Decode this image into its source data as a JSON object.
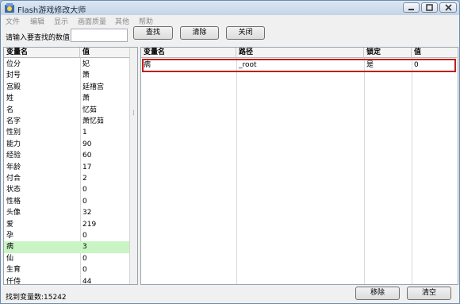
{
  "window": {
    "title": "Flash游戏修改大师",
    "icon": "app-icon",
    "controls": [
      "minimize-icon",
      "maximize-icon",
      "close-icon"
    ]
  },
  "menu": [
    "文件",
    "编辑",
    "显示",
    "画面质量",
    "其他",
    "帮助"
  ],
  "search": {
    "label": "请输入要查找的数值",
    "value": "",
    "find_label": "查找",
    "clear_label": "清除",
    "close_label": "关闭"
  },
  "left_table": {
    "headers": [
      "变量名",
      "值"
    ],
    "rows": [
      [
        "位分",
        "妃"
      ],
      [
        "封号",
        "箫"
      ],
      [
        "宫殿",
        "延禧宫"
      ],
      [
        "姓",
        "萧"
      ],
      [
        "名",
        "忆茹"
      ],
      [
        "名字",
        "萧忆茹"
      ],
      [
        "性别",
        "1"
      ],
      [
        "能力",
        "90"
      ],
      [
        "经验",
        "60"
      ],
      [
        "年龄",
        "17"
      ],
      [
        "付合",
        "2"
      ],
      [
        "状态",
        "0"
      ],
      [
        "性格",
        "0"
      ],
      [
        "头像",
        "32"
      ],
      [
        "爱",
        "219"
      ],
      [
        "孕",
        "0"
      ],
      [
        "病",
        "3"
      ],
      [
        "仙",
        "0"
      ],
      [
        "生育",
        "0"
      ],
      [
        "仟侍",
        "44"
      ]
    ],
    "selected_row": 16
  },
  "right_table": {
    "headers": [
      "变量名",
      "路径",
      "锁定",
      "值"
    ],
    "rows": [
      [
        "病",
        "_root",
        "是",
        "0"
      ]
    ]
  },
  "status": {
    "text": "找到变量数:15242",
    "remove_label": "移除",
    "clear_label": "清空"
  },
  "colors": {
    "highlight_border": "#c0201f",
    "selected_row": "#c9f5c4"
  }
}
